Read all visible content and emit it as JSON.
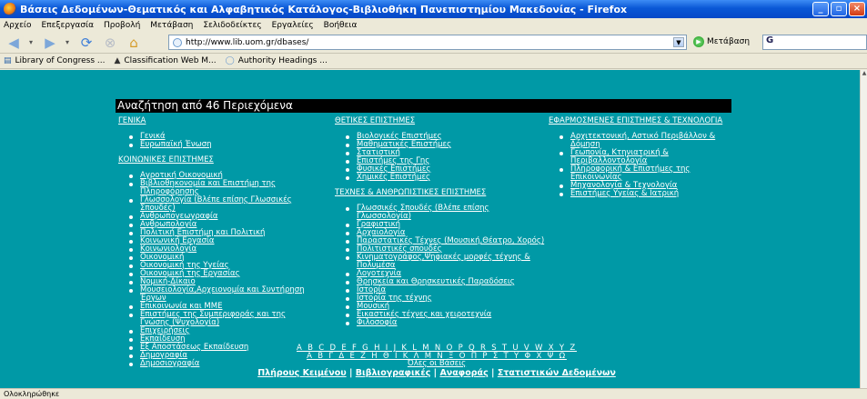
{
  "window": {
    "title": "Βάσεις Δεδομένων-Θεματικός και Αλφαβητικός Κατάλογος-Βιβλιοθήκη Πανεπιστημίου Μακεδονίας - Firefox"
  },
  "menu": [
    "Αρχείο",
    "Επεξεργασία",
    "Προβολή",
    "Μετάβαση",
    "Σελιδοδείκτες",
    "Εργαλείες",
    "Βοήθεια"
  ],
  "navbar": {
    "url": "http://www.lib.uom.gr/dbases/",
    "go_label": "Μετάβαση",
    "search_value": "G"
  },
  "bookmarks": [
    "Library of Congress ...",
    "Classification Web M...",
    "Authority Headings ..."
  ],
  "page": {
    "heading": "Αναζήτηση από 46 Περιεχόμενα",
    "col1": {
      "sections": [
        {
          "title": "ΓΕΝΙΚΑ",
          "items": [
            "Γενικά",
            "Ευρωπαϊκή Ένωση"
          ]
        },
        {
          "title": "ΚΟΙΝΩΝΙΚΕΣ ΕΠΙΣΤΗΜΕΣ",
          "items": [
            "Αγροτική Οικονομική",
            "Βιβλιοθηκονομία και Επιστήμη της Πληροφόρησης",
            "Γλωσσολογία (Βλέπε επίσης Γλωσσικές Σπουδές)",
            "Ανθρωπογεωγραφία",
            "Ανθρωπολογία",
            "Πολιτική Επιστήμη και Πολιτική",
            "Κοινωνική Εργασία",
            "Κοινωνιολογία",
            "Οικονομική",
            "Οικονομική της Υγείας",
            "Οικονομική της Εργασίας",
            "Νομική-Δίκαιο",
            "Μουσειολογία,Αρχειονομία και Συντήρηση Έργων",
            "Επικοινωνία και ΜΜΕ",
            "Επιστήμες της Συμπεριφοράς και της Γνώσης (Ψυχολογία)",
            "Επιχειρήσεις",
            "Εκπαίδευση",
            "Εξ Αποστάσεως Εκπαίδευση",
            "Δημογραφία",
            "Δημοσιογραφία"
          ]
        }
      ]
    },
    "col2": {
      "sections": [
        {
          "title": "ΘΕΤΙΚΕΣ ΕΠΙΣΤΗΜΕΣ",
          "items": [
            "Βιολογικές Επιστήμες",
            "Μαθηματικές Επιστήμες",
            "Στατιστική",
            "Επιστήμες της Γης",
            "Φυσικές Επιστήμες",
            "Χημικές Επιστήμες"
          ]
        },
        {
          "title": "ΤΕΧΝΕΣ & ΑΝΘΡΩΠΙΣΤΙΚΕΣ ΕΠΙΣΤΗΜΕΣ",
          "items": [
            "Γλωσσικές Σπουδές (Βλέπε επίσης Γλωσσολογία)",
            "Γραφιστική",
            "Αρχαιολογία",
            "Παραστατικές Τέχνες (Μουσική,Θέατρο, Χορός)",
            "Πολιτιστικές σπουδές",
            "Κινηματογράφος,Ψηφιακές μορφές τέχνης & Πολυμέσα",
            "Λογοτεχνία",
            "Θρησκεία και Θρησκευτικές Παραδόσεις",
            "Ιστορία",
            "Ιστορία της τέχνης",
            "Μουσική",
            "Εικαστικές τέχνες και χειροτεχνία",
            "Φιλοσοφία"
          ]
        }
      ]
    },
    "col3": {
      "sections": [
        {
          "title": "ΕΦΑΡΜΟΣΜΕΝΕΣ ΕΠΙΣΤΗΜΕΣ & ΤΕΧΝΟΛΟΓΙΑ",
          "items": [
            "Αρχιτεκτονική, Αστικό Περιβάλλον & Δόμηση",
            "Γεωπονία, Κτηνιατρική & Περιβαλλοντολογία",
            "Πληροφορική & Επιστήμες της Επικοινωνίας",
            "Μηχανολογία & Τεχνολογία",
            "Επιστήμες Υγείας & Ιατρική"
          ]
        }
      ]
    },
    "alphabet_latin": "A B C D E F G H I J K L M N O P Q R S T U V W X Y Z",
    "alphabet_greek": "Α Β Γ Δ Ε Ζ Η Θ Ι Κ Λ Μ Ν Ξ Ο Π Ρ Σ Τ Υ Φ Χ Ψ Ω",
    "all_label": "Όλες οι Βάσεις",
    "footer_links": [
      "Πλήρους Κειμένου",
      "Βιβλιογραφικές",
      "Αναφοράς",
      "Στατιστικών Δεδομένων"
    ],
    "footer_sep": "|"
  },
  "status": "Ολοκληρώθηκε",
  "colors": {
    "content_bg": "#0099a6",
    "title_bar": "#0a58d6",
    "heading_bg": "#000000"
  },
  "icons": [
    "back-icon",
    "forward-icon",
    "reload-icon",
    "stop-icon",
    "home-icon",
    "go-icon",
    "firefox-icon"
  ]
}
